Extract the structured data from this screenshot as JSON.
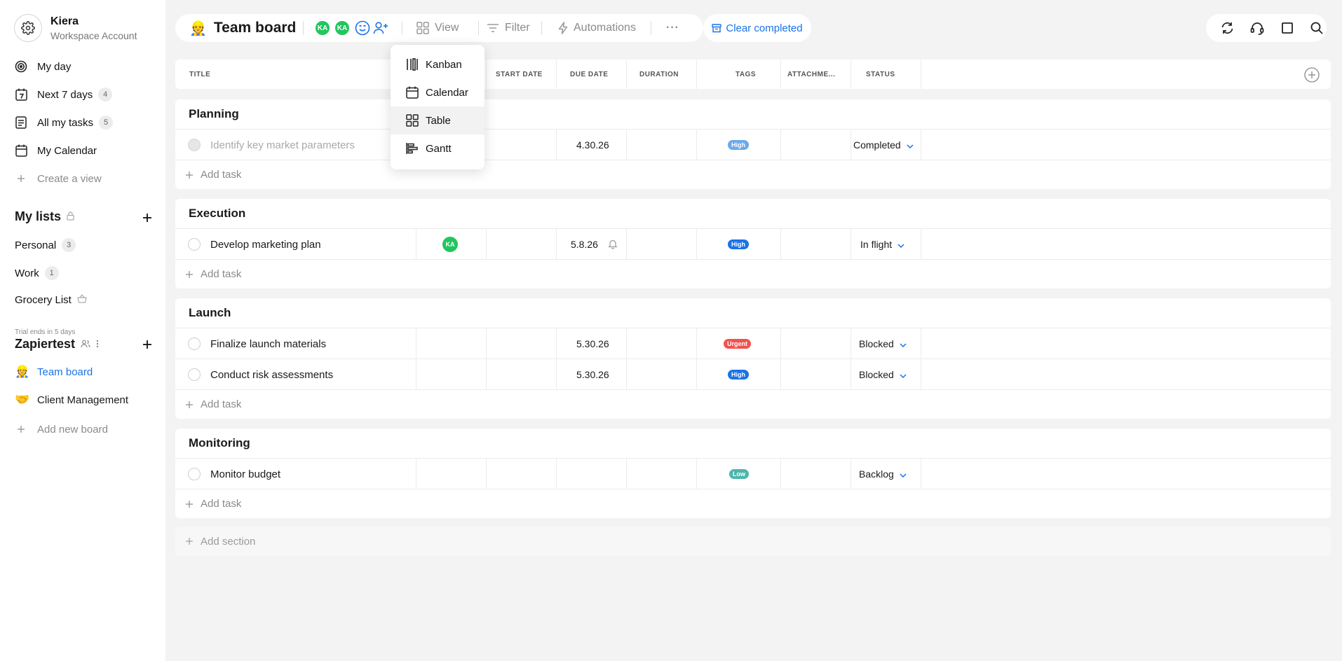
{
  "account": {
    "name": "Kiera",
    "subtitle": "Workspace Account"
  },
  "nav": [
    {
      "label": "My day",
      "icon": "target-icon"
    },
    {
      "label": "Next 7 days",
      "icon": "calendar-7-icon",
      "count": "4"
    },
    {
      "label": "All my tasks",
      "icon": "tasks-list-icon",
      "count": "5"
    },
    {
      "label": "My Calendar",
      "icon": "calendar-icon"
    },
    {
      "label": "Create a view",
      "icon": "plus-icon"
    }
  ],
  "my_lists": {
    "title": "My lists",
    "items": [
      {
        "label": "Personal",
        "count": "3"
      },
      {
        "label": "Work",
        "count": "1"
      },
      {
        "label": "Grocery List",
        "icon": "basket-icon"
      }
    ]
  },
  "workspace": {
    "trial": "Trial ends in 5 days",
    "name": "Zapiertest",
    "boards": [
      {
        "label": "Team board",
        "emoji": "👷",
        "active": true
      },
      {
        "label": "Client Management",
        "emoji": "🤝"
      }
    ],
    "add_board": "Add new board"
  },
  "topbar": {
    "board_title": "Team board",
    "board_emoji": "👷",
    "avatars": [
      "KA",
      "KA"
    ],
    "view_label": "View",
    "filter_label": "Filter",
    "automations_label": "Automations",
    "more_label": "···",
    "clear_completed": "Clear completed"
  },
  "view_menu": {
    "items": [
      {
        "label": "Kanban",
        "icon": "kanban-icon"
      },
      {
        "label": "Calendar",
        "icon": "calendar-icon"
      },
      {
        "label": "Table",
        "icon": "table-grid-icon",
        "active": true
      },
      {
        "label": "Gantt",
        "icon": "gantt-icon"
      }
    ]
  },
  "columns": [
    "TITLE",
    "START DATE",
    "DUE DATE",
    "DURATION",
    "TAGS",
    "ATTACHME...",
    "STATUS"
  ],
  "sections": [
    {
      "name": "Planning",
      "tasks": [
        {
          "title": "Identify key market parameters",
          "due": "4.30.26",
          "tag": "High",
          "tag_color": "#6aa9ec",
          "status": "Completed",
          "completed": true
        }
      ]
    },
    {
      "name": "Execution",
      "tasks": [
        {
          "title": "Develop marketing plan",
          "assignee": "KA",
          "due": "5.8.26",
          "reminder": true,
          "tag": "High",
          "tag_color": "#1a73e8",
          "status": "In flight"
        }
      ]
    },
    {
      "name": "Launch",
      "tasks": [
        {
          "title": "Finalize launch materials",
          "due": "5.30.26",
          "tag": "Urgent",
          "tag_color": "#ef5350",
          "status": "Blocked"
        },
        {
          "title": "Conduct risk assessments",
          "due": "5.30.26",
          "tag": "High",
          "tag_color": "#1a73e8",
          "status": "Blocked"
        }
      ]
    },
    {
      "name": "Monitoring",
      "tasks": [
        {
          "title": "Monitor budget",
          "tag": "Low",
          "tag_color": "#4db6ac",
          "status": "Backlog"
        }
      ]
    }
  ],
  "add_task_label": "Add task",
  "add_section_label": "Add section"
}
